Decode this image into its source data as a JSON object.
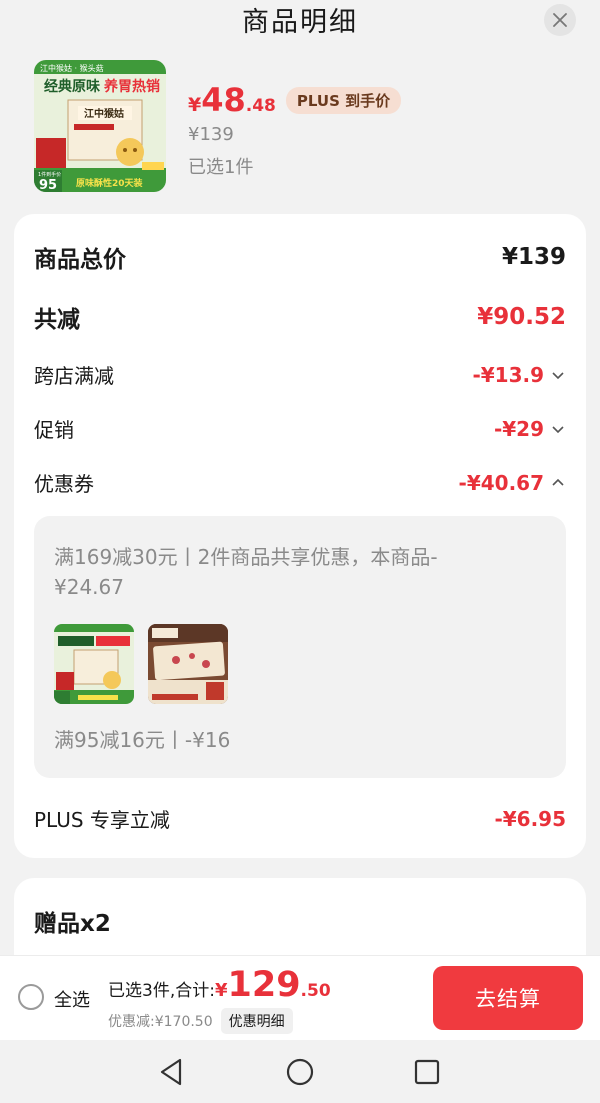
{
  "header": {
    "title": "商品明细"
  },
  "product": {
    "price_yen": "¥",
    "price_int": "48",
    "price_dec": ".48",
    "plus_tag": "PLUS 到手价",
    "original_price": "¥139",
    "selected": "已选1件",
    "image": {
      "brand": "江中猴姑",
      "top_banner": "江中猴姑 · 猴头菇",
      "headline_a": "经典原味",
      "headline_b": "养胃热销",
      "box_label": "江中猴姑",
      "badge_price": "95",
      "badge_small": "1件到手价",
      "bottom_text": "原味酥性20天装",
      "side_text": "百家养胃1盒"
    }
  },
  "summary": {
    "total_label": "商品总价",
    "total_value": "¥139",
    "reduce_label": "共减",
    "reduce_value": "¥90.52",
    "cross_store_label": "跨店满减",
    "cross_store_value": "-¥13.9",
    "promo_label": "促销",
    "promo_value": "-¥29",
    "coupon_label": "优惠券",
    "coupon_value": "-¥40.67",
    "plus_label": "PLUS 专享立减",
    "plus_value": "-¥6.95"
  },
  "coupon_detail": {
    "line1": "满169减30元丨2件商品共享优惠，本商品-¥24.67",
    "line2": "满95减16元丨-¥16",
    "thumb2_tag": "江中猴姑"
  },
  "gift": {
    "title": "赠品x2"
  },
  "footer": {
    "select_all": "全选",
    "total_prefix": "已选3件,合计:",
    "total_yen": "¥",
    "total_int": "129",
    "total_dec": ".50",
    "discount_text": "优惠减:¥170.50",
    "detail_button": "优惠明细",
    "checkout_button": "去结算"
  },
  "colors": {
    "accent_red": "#e8313a",
    "button_red": "#f03a3f",
    "plus_tag_bg": "#f6ded2",
    "package_green": "#3f9a3a"
  },
  "icons": [
    "close-icon",
    "chevron-down-icon",
    "chevron-up-icon",
    "back-triangle-icon",
    "home-circle-icon",
    "recents-square-icon"
  ]
}
